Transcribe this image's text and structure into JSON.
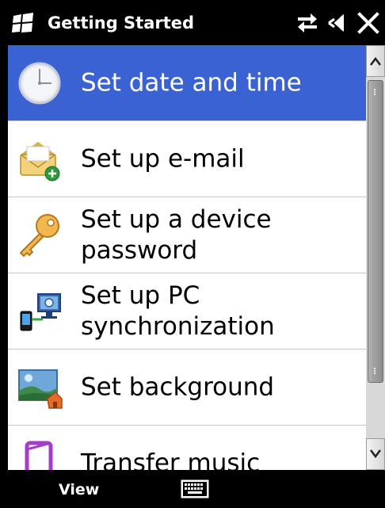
{
  "titlebar": {
    "title": "Getting Started",
    "icons": [
      "windows-logo-icon",
      "connectivity-arrows-icon",
      "speaker-muted-icon",
      "close-icon"
    ]
  },
  "list": {
    "items": [
      {
        "label": "Set date and time",
        "icon": "clock-icon",
        "selected": true
      },
      {
        "label": "Set up e-mail",
        "icon": "email-add-icon",
        "selected": false
      },
      {
        "label": "Set up a device password",
        "icon": "key-icon",
        "selected": false
      },
      {
        "label": "Set up PC synchronization",
        "icon": "pc-sync-icon",
        "selected": false
      },
      {
        "label": "Set background",
        "icon": "background-picture-icon",
        "selected": false
      },
      {
        "label": "Transfer music",
        "icon": "music-transfer-icon",
        "selected": false
      }
    ]
  },
  "colors": {
    "selection": "#3a62d3",
    "background": "#ffffff",
    "bars": "#000000"
  },
  "softbar": {
    "left_label": "View",
    "center_icon": "keyboard-icon"
  }
}
